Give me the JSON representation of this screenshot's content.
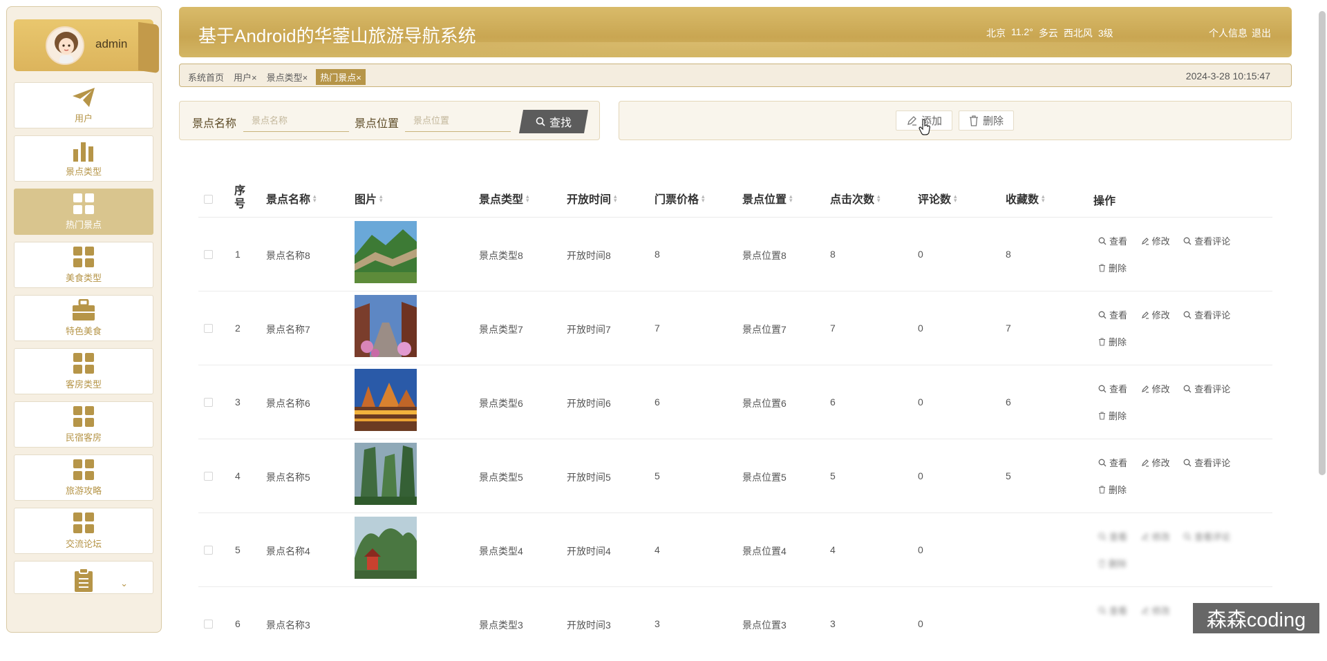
{
  "user": {
    "name": "admin"
  },
  "sidebar": {
    "items": [
      {
        "label": "用户",
        "icon": "paper-plane-icon"
      },
      {
        "label": "景点类型",
        "icon": "bar-chart-icon"
      },
      {
        "label": "热门景点",
        "icon": "grid-icon",
        "active": true
      },
      {
        "label": "美食类型",
        "icon": "grid-icon"
      },
      {
        "label": "特色美食",
        "icon": "briefcase-icon"
      },
      {
        "label": "客房类型",
        "icon": "grid-icon"
      },
      {
        "label": "民宿客房",
        "icon": "grid-icon"
      },
      {
        "label": "旅游攻略",
        "icon": "grid-icon"
      },
      {
        "label": "交流论坛",
        "icon": "grid-icon"
      }
    ],
    "more_icon": "clipboard-icon"
  },
  "header": {
    "title": "基于Android的华蓥山旅游导航系统",
    "weather": {
      "city": "北京",
      "temp": "11.2°",
      "condition": "多云",
      "wind": "西北风",
      "level": "3级"
    },
    "profile_link": "个人信息",
    "logout_link": "退出"
  },
  "tabs": {
    "items": [
      "系统首页",
      "用户×",
      "景点类型×",
      "热门景点×"
    ],
    "datetime": "2024-3-28 10:15:47"
  },
  "search": {
    "name_label": "景点名称",
    "name_placeholder": "景点名称",
    "location_label": "景点位置",
    "location_placeholder": "景点位置",
    "button": "查找"
  },
  "actions": {
    "add": "添加",
    "delete": "删除"
  },
  "table": {
    "columns": {
      "index": "序号",
      "name": "景点名称",
      "image": "图片",
      "type": "景点类型",
      "open_time": "开放时间",
      "price": "门票价格",
      "location": "景点位置",
      "clicks": "点击次数",
      "comments": "评论数",
      "favorites": "收藏数",
      "ops": "操作"
    },
    "op_labels": {
      "view": "查看",
      "edit": "修改",
      "view_comments": "查看评论",
      "delete": "删除"
    },
    "rows": [
      {
        "index": "1",
        "name": "景点名称8",
        "type": "景点类型8",
        "open_time": "开放时间8",
        "price": "8",
        "location": "景点位置8",
        "clicks": "8",
        "comments": "0",
        "favorites": "8"
      },
      {
        "index": "2",
        "name": "景点名称7",
        "type": "景点类型7",
        "open_time": "开放时间7",
        "price": "7",
        "location": "景点位置7",
        "clicks": "7",
        "comments": "0",
        "favorites": "7"
      },
      {
        "index": "3",
        "name": "景点名称6",
        "type": "景点类型6",
        "open_time": "开放时间6",
        "price": "6",
        "location": "景点位置6",
        "clicks": "6",
        "comments": "0",
        "favorites": "6"
      },
      {
        "index": "4",
        "name": "景点名称5",
        "type": "景点类型5",
        "open_time": "开放时间5",
        "price": "5",
        "location": "景点位置5",
        "clicks": "5",
        "comments": "0",
        "favorites": "5"
      },
      {
        "index": "5",
        "name": "景点名称4",
        "type": "景点类型4",
        "open_time": "开放时间4",
        "price": "4",
        "location": "景点位置4",
        "clicks": "4",
        "comments": "0",
        "favorites": ""
      },
      {
        "index": "6",
        "name": "景点名称3",
        "type": "景点类型3",
        "open_time": "开放时间3",
        "price": "3",
        "location": "景点位置3",
        "clicks": "3",
        "comments": "0",
        "favorites": ""
      }
    ]
  },
  "watermark": "森森coding",
  "colors": {
    "accent": "#b69548",
    "header": "#c9a652",
    "active_nav": "#d9c58e",
    "search_button": "#5c5c5c"
  }
}
